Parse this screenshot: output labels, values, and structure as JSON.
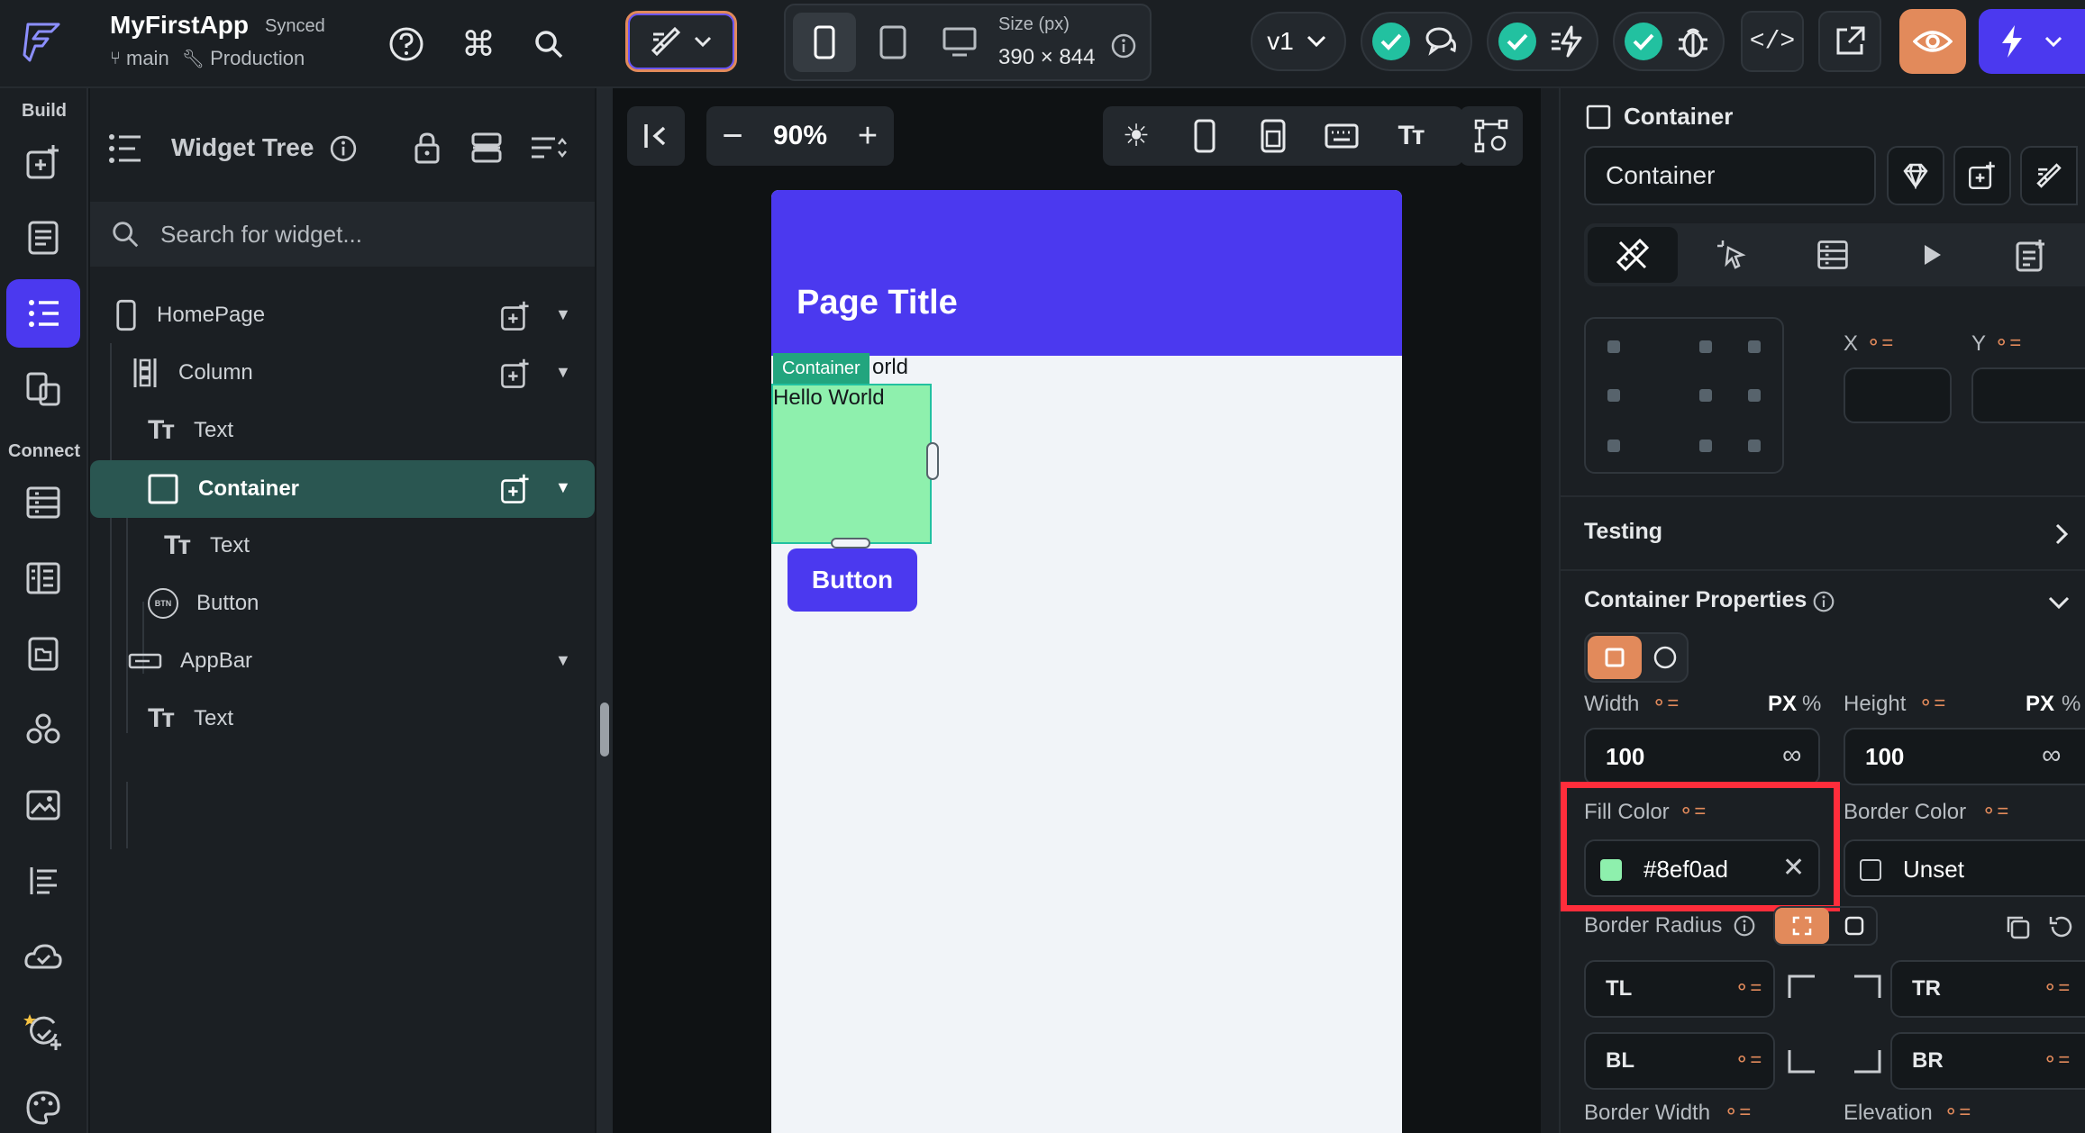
{
  "app": {
    "name": "MyFirstApp",
    "sync_status": "Synced",
    "branch": "main",
    "environment": "Production"
  },
  "device": {
    "size_label": "Size (px)",
    "size_value": "390 × 844"
  },
  "version": {
    "label": "v1"
  },
  "rail": {
    "build_label": "Build",
    "connect_label": "Connect"
  },
  "tree": {
    "title": "Widget Tree",
    "search_placeholder": "Search for widget...",
    "items": [
      {
        "label": "HomePage"
      },
      {
        "label": "Column"
      },
      {
        "label": "Text"
      },
      {
        "label": "Container"
      },
      {
        "label": "Text"
      },
      {
        "label": "Button"
      },
      {
        "label": "AppBar"
      },
      {
        "label": "Text"
      }
    ],
    "btn_icon_text": "BTN"
  },
  "canvas": {
    "zoom": "90%",
    "page_title": "Page Title",
    "container_tag": "Container",
    "partial_text": "orld",
    "hello_text": "Hello World",
    "button_label": "Button",
    "appbar_color": "#4b39ef",
    "container_color": "#8ef0ad"
  },
  "props": {
    "widget_type": "Container",
    "widget_name": "Container",
    "x_label": "X",
    "y_label": "Y",
    "testing_label": "Testing",
    "container_props_label": "Container Properties",
    "width_label": "Width",
    "height_label": "Height",
    "px_label": "PX",
    "pct_label": "%",
    "width_value": "100",
    "height_value": "100",
    "fill_color_label": "Fill Color",
    "fill_color_value": "#8ef0ad",
    "border_color_label": "Border Color",
    "border_color_value": "Unset",
    "border_radius_label": "Border Radius",
    "tl": "TL",
    "tr": "TR",
    "bl": "BL",
    "br": "BR",
    "border_width_label": "Border Width",
    "elevation_label": "Elevation"
  },
  "colors": {
    "accent": "#4b39ef",
    "orange": "#e28a5b",
    "green": "#22c1a0",
    "highlight": "#ff2d3b"
  }
}
